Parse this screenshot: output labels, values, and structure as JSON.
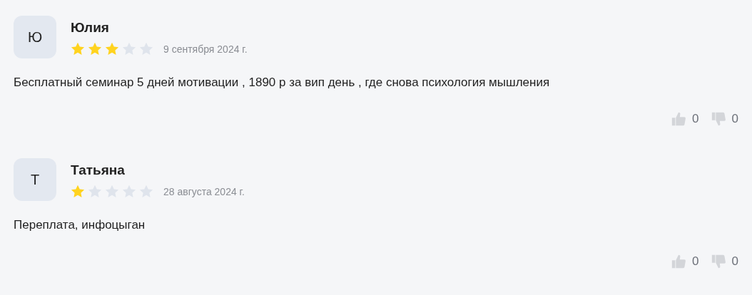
{
  "reviews": [
    {
      "initial": "Ю",
      "name": "Юлия",
      "stars": 3,
      "date": "9 сентября 2024 г.",
      "text": "Бесплатный семинар 5 дней мотивации , 1890 р за вип день , где снова психология мышления",
      "likes": "0",
      "dislikes": "0"
    },
    {
      "initial": "Т",
      "name": "Татьяна",
      "stars": 1,
      "date": "28 августа 2024 г.",
      "text": "Переплата, инфоцыган",
      "likes": "0",
      "dislikes": "0"
    }
  ]
}
